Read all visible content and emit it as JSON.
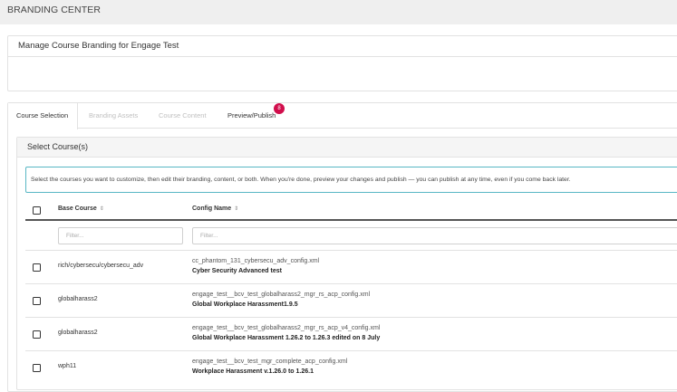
{
  "page": {
    "title": "BRANDING CENTER"
  },
  "manage": {
    "title": "Manage Course Branding for Engage Test"
  },
  "tabs": [
    {
      "label": "Course Selection",
      "state": "active"
    },
    {
      "label": "Branding Assets",
      "state": "disabled"
    },
    {
      "label": "Course Content",
      "state": "disabled"
    },
    {
      "label": "Preview/Publish",
      "state": "enabled",
      "badge": "8"
    }
  ],
  "select": {
    "title": "Select Course(s)",
    "info": "Select the courses you want to customize, then edit their branding, content, or both. When you're done, preview your changes and publish — you can publish at any time, even if you come back later."
  },
  "table": {
    "columns": {
      "base": "Base Course",
      "config": "Config Name",
      "sort_icon": "⇕"
    },
    "filters": {
      "base_placeholder": "Filter...",
      "config_placeholder": "Filter..."
    },
    "rows": [
      {
        "base": "rich/cybersecu/cybersecu_adv",
        "file": "cc_phantom_131_cybersecu_adv_config.xml",
        "name": "Cyber Security Advanced test"
      },
      {
        "base": "globalharass2",
        "file": "engage_test__bcv_test_globalharass2_mgr_rs_acp_config.xml",
        "name": "Global Workplace Harassment1.9.5"
      },
      {
        "base": "globalharass2",
        "file": "engage_test__bcv_test_globalharass2_mgr_rs_acp_v4_config.xml",
        "name": "Global Workplace Harassment 1.26.2 to 1.26.3 edited on 8 July"
      },
      {
        "base": "wph11",
        "file": "engage_test__bcv_test_mgr_complete_acp_config.xml",
        "name": "Workplace Harassment v.1.26.0 to 1.26.1"
      }
    ]
  },
  "colors": {
    "badge": "#d10e4c",
    "info_border": "#58b7c4",
    "header_bg": "#efefef"
  }
}
